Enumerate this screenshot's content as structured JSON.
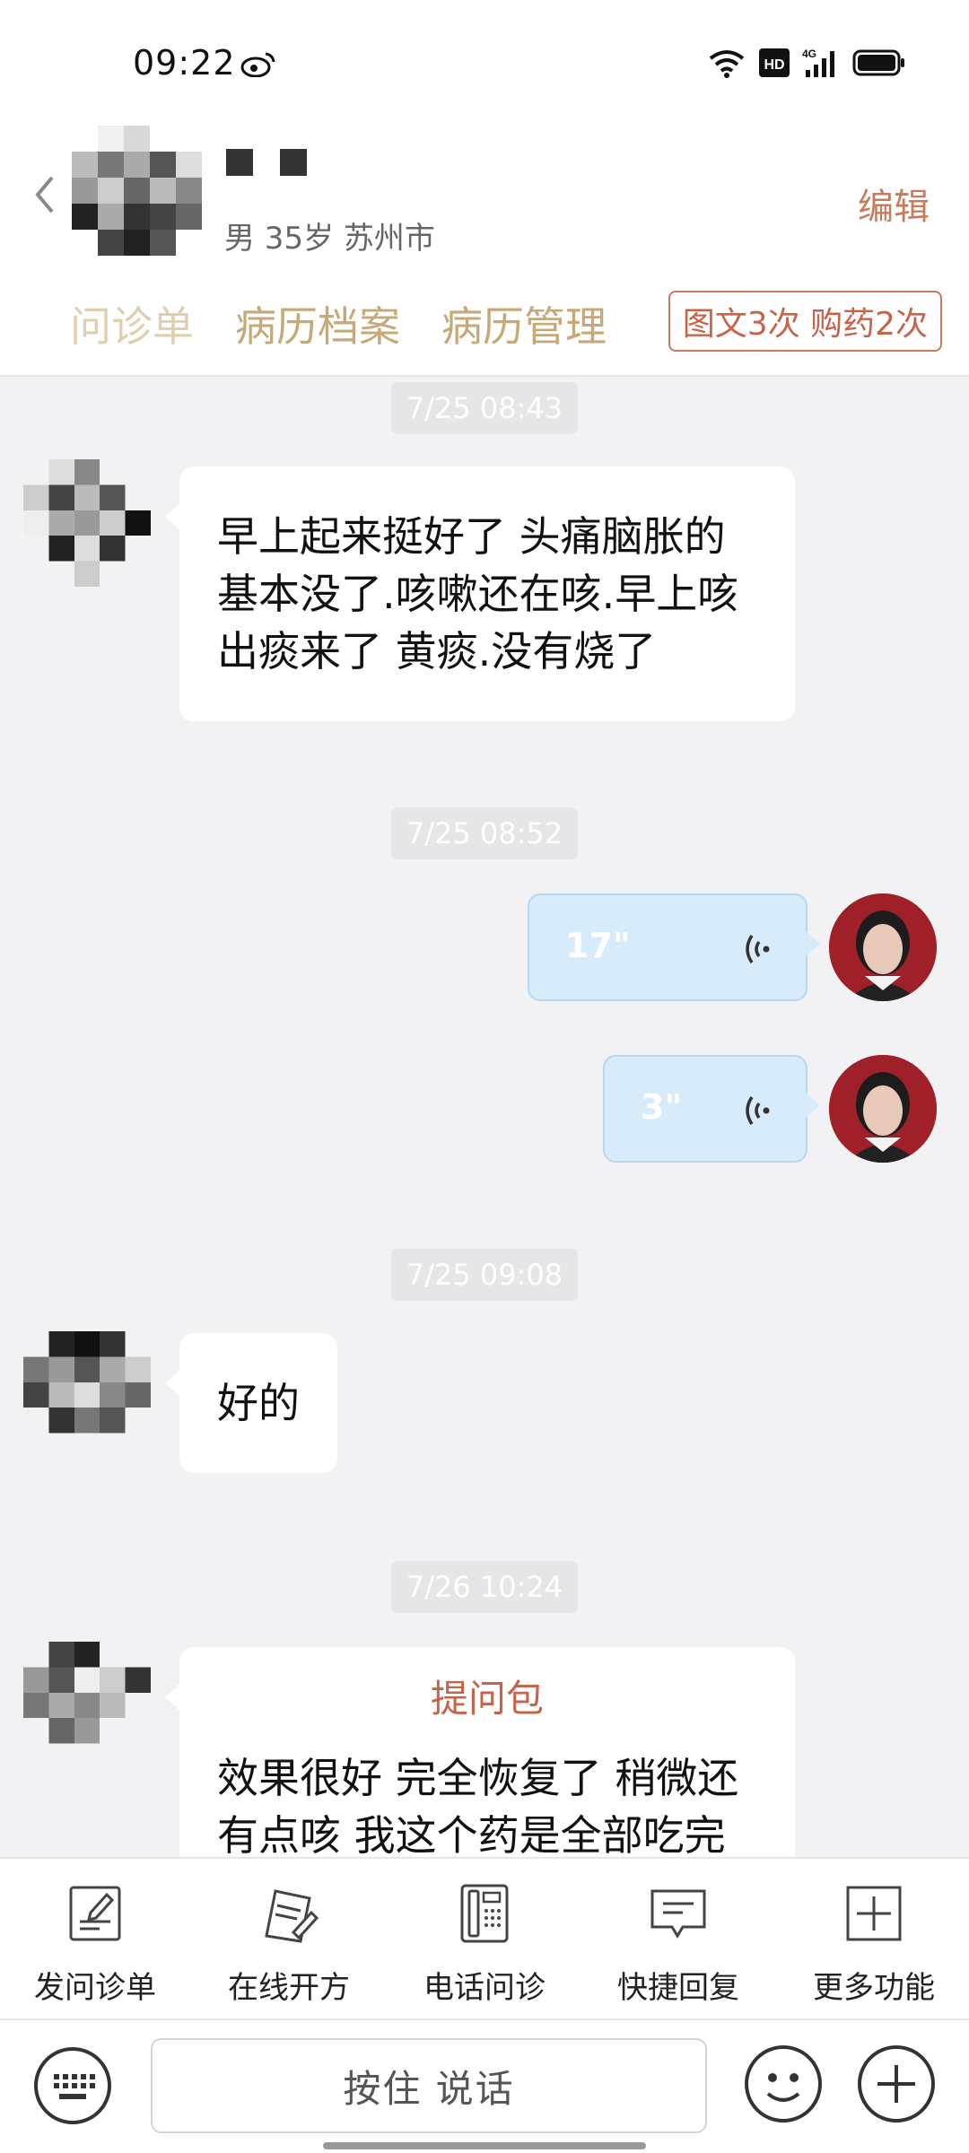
{
  "status_bar": {
    "time": "09:22",
    "icons": [
      "weibo-icon",
      "wifi-icon",
      "hd-icon",
      "signal-4g-icon",
      "battery-icon"
    ],
    "hd_label": "HD",
    "network_label": "4G"
  },
  "header": {
    "patient_meta": "男 35岁  苏州市",
    "edit_label": "编辑",
    "tabs": [
      {
        "label": "问诊单"
      },
      {
        "label": "病历档案"
      },
      {
        "label": "病历管理"
      }
    ],
    "quota_badge": "图文3次 购药2次"
  },
  "chat": {
    "messages": [
      {
        "type": "timestamp",
        "text": "7/25 08:43"
      },
      {
        "type": "patient_text",
        "text": "早上起来挺好了  头痛脑胀的基本没了.咳嗽还在咳.早上咳出痰来了 黄痰.没有烧了"
      },
      {
        "type": "timestamp",
        "text": "7/25 08:52"
      },
      {
        "type": "doctor_voice",
        "duration": "17\""
      },
      {
        "type": "doctor_voice",
        "duration": "3\""
      },
      {
        "type": "timestamp",
        "text": "7/25 09:08"
      },
      {
        "type": "patient_text",
        "text": "好的"
      },
      {
        "type": "timestamp",
        "text": "7/26 10:24"
      },
      {
        "type": "patient_card",
        "title": "提问包",
        "text": "效果很好 完全恢复了 稍微还有点咳  我这个药是全部吃完"
      }
    ]
  },
  "toolbar": {
    "items": [
      {
        "label": "发问诊单",
        "icon": "form-edit-icon"
      },
      {
        "label": "在线开方",
        "icon": "prescription-icon"
      },
      {
        "label": "电话问诊",
        "icon": "phone-icon"
      },
      {
        "label": "快捷回复",
        "icon": "quick-reply-icon"
      },
      {
        "label": "更多功能",
        "icon": "plus-square-icon"
      }
    ]
  },
  "input_bar": {
    "hold_to_talk_label": "按住 说话"
  },
  "colors": {
    "accent": "#c8634a",
    "tab_gold": "#c7a978",
    "voice_bubble": "#d7ebfa",
    "background": "#f2f2f4"
  }
}
